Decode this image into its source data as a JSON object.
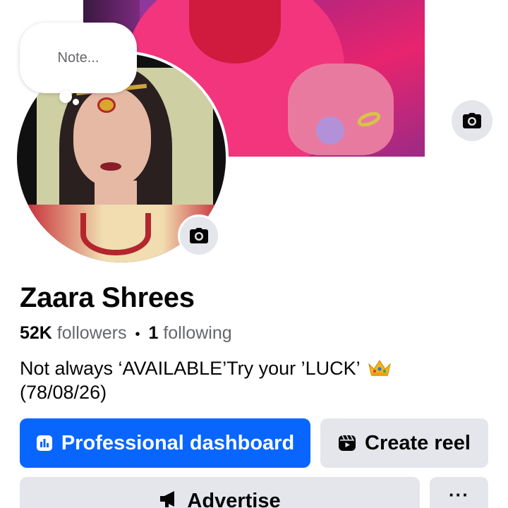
{
  "note": {
    "placeholder": "Note..."
  },
  "profile": {
    "name": "Zaara Shrees",
    "followers_count": "52K",
    "followers_label": "followers",
    "separator": "•",
    "following_count": "1",
    "following_label": "following",
    "bio_line1": "Not always ‘AVAILABLE’Try your ’LUCK’",
    "bio_emoji": "crown-emoji",
    "bio_line2": "(78/08/26)"
  },
  "actions": {
    "professional_dashboard": "Professional dashboard",
    "create_reel": "Create reel",
    "advertise": "Advertise",
    "more": "···"
  },
  "icons": {
    "cover_camera": "camera-icon",
    "avatar_camera": "camera-icon",
    "dashboard": "bar-chart-icon",
    "reel": "reel-icon",
    "advertise": "megaphone-icon"
  },
  "colors": {
    "primary": "#0866ff",
    "secondary_button": "#e4e6eb",
    "muted_text": "#65676b"
  }
}
